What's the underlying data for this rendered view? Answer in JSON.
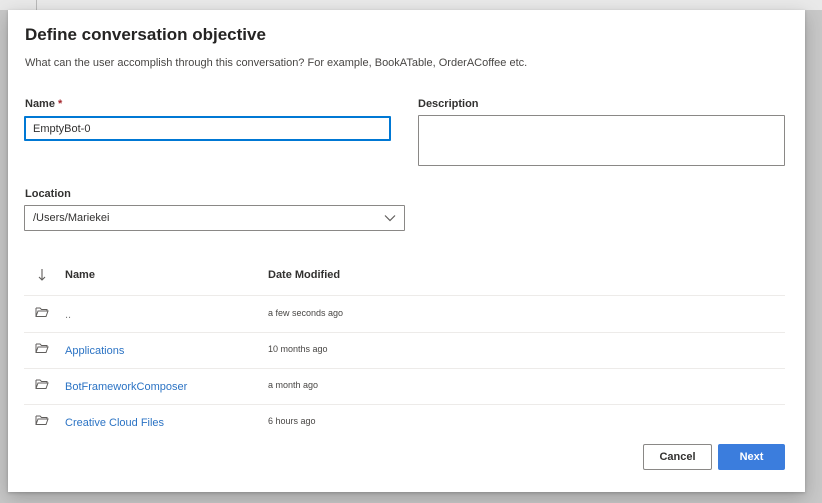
{
  "dialog": {
    "title": "Define conversation objective",
    "subtitle": "What can the user accomplish through this conversation? For example, BookATable, OrderACoffee etc."
  },
  "form": {
    "name_label": "Name",
    "name_required_marker": "*",
    "name_value": "EmptyBot-0",
    "description_label": "Description",
    "description_value": "",
    "location_label": "Location",
    "location_value": "/Users/Mariekei"
  },
  "table": {
    "headers": {
      "sort_icon": "arrow-down-icon",
      "name": "Name",
      "date_modified": "Date Modified"
    },
    "rows": [
      {
        "name": "..",
        "date": "a few seconds ago",
        "icon": "folder-open-icon"
      },
      {
        "name": "Applications",
        "date": "10 months ago",
        "icon": "folder-open-icon"
      },
      {
        "name": "BotFrameworkComposer",
        "date": "a month ago",
        "icon": "folder-open-icon"
      },
      {
        "name": "Creative Cloud Files",
        "date": "6 hours ago",
        "icon": "folder-open-icon"
      }
    ]
  },
  "buttons": {
    "cancel": "Cancel",
    "next": "Next"
  },
  "colors": {
    "accent": "#3b7ddd",
    "link": "#2b73c4",
    "required": "#a4262c",
    "focus_border": "#0078d4"
  }
}
